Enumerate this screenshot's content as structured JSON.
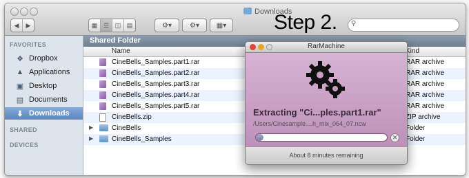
{
  "window": {
    "title": "Downloads",
    "step_caption": "Step 2."
  },
  "toolbar": {
    "view_icons": [
      "icon-view-icon",
      "list-view-icon",
      "column-view-icon",
      "coverflow-view-icon"
    ],
    "action_button": "gear-icon",
    "share_button": "arrange-icon",
    "arrange_button": "list-arrange-icon"
  },
  "sidebar": {
    "favorites_header": "FAVORITES",
    "items": [
      {
        "label": "Dropbox",
        "icon": "dropbox-icon"
      },
      {
        "label": "Applications",
        "icon": "applications-icon"
      },
      {
        "label": "Desktop",
        "icon": "desktop-icon"
      },
      {
        "label": "Documents",
        "icon": "documents-icon"
      },
      {
        "label": "Downloads",
        "icon": "downloads-icon",
        "selected": true
      }
    ],
    "shared_header": "SHARED",
    "devices_header": "DEVICES"
  },
  "content": {
    "path_title": "Shared Folder",
    "columns": {
      "name": "Name",
      "kind": "Kind"
    },
    "files": [
      {
        "name": "CineBells_Samples.part1.rar",
        "kind": "RAR archive",
        "type": "rar"
      },
      {
        "name": "CineBells_Samples.part2.rar",
        "kind": "RAR archive",
        "type": "rar"
      },
      {
        "name": "CineBells_Samples.part3.rar",
        "kind": "RAR archive",
        "type": "rar"
      },
      {
        "name": "CineBells_Samples.part4.rar",
        "kind": "RAR archive",
        "type": "rar"
      },
      {
        "name": "CineBells_Samples.part5.rar",
        "kind": "RAR archive",
        "type": "rar"
      },
      {
        "name": "CineBells.zip",
        "kind": "ZIP archive",
        "type": "zip"
      },
      {
        "name": "CineBells",
        "kind": "Folder",
        "type": "folder"
      },
      {
        "name": "CineBells_Samples",
        "kind": "Folder",
        "type": "folder"
      }
    ]
  },
  "dialog": {
    "title": "RarMachine",
    "extracting": "Extracting \"Ci...ples.part1.rar\"",
    "path": "/Users/Cinesample....h_mix_064_07.ncw",
    "progress_fraction": 0.06,
    "remaining": "About 8 minutes remaining",
    "colors": {
      "background": "#c59ec0",
      "gears": "#111111"
    }
  }
}
